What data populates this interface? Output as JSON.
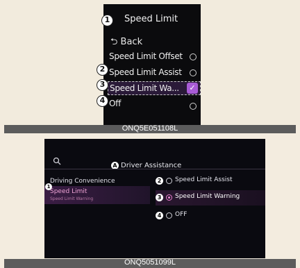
{
  "top": {
    "title": "Speed Limit",
    "back_label": "⮌ Back",
    "items": [
      {
        "label": "Speed Limit Offset",
        "callout": ""
      },
      {
        "label": "Speed Limit Assist",
        "callout": "2"
      },
      {
        "label": "Speed Limit Wa...",
        "callout": "3",
        "selected": true
      },
      {
        "label": "Off",
        "callout": "4"
      }
    ],
    "title_callout": "1",
    "caption": "ONQ5E051108L"
  },
  "bottom": {
    "search_icon": "search-icon",
    "header_marker": "A",
    "header_title": "Driver Assistance",
    "category": "Driving Convenience",
    "left_marker": "1",
    "selected_item": "Speed Limit",
    "selected_subtext": "Speed Limit Warning",
    "options": [
      {
        "marker": "2",
        "label": "Speed Limit Assist"
      },
      {
        "marker": "3",
        "label": "Speed Limit Warning",
        "selected": true
      },
      {
        "marker": "4",
        "label": "OFF"
      }
    ],
    "caption": "ONQ5051099L"
  },
  "colors": {
    "accent": "#a85bd6",
    "highlight_text": "#f0a4d6"
  }
}
